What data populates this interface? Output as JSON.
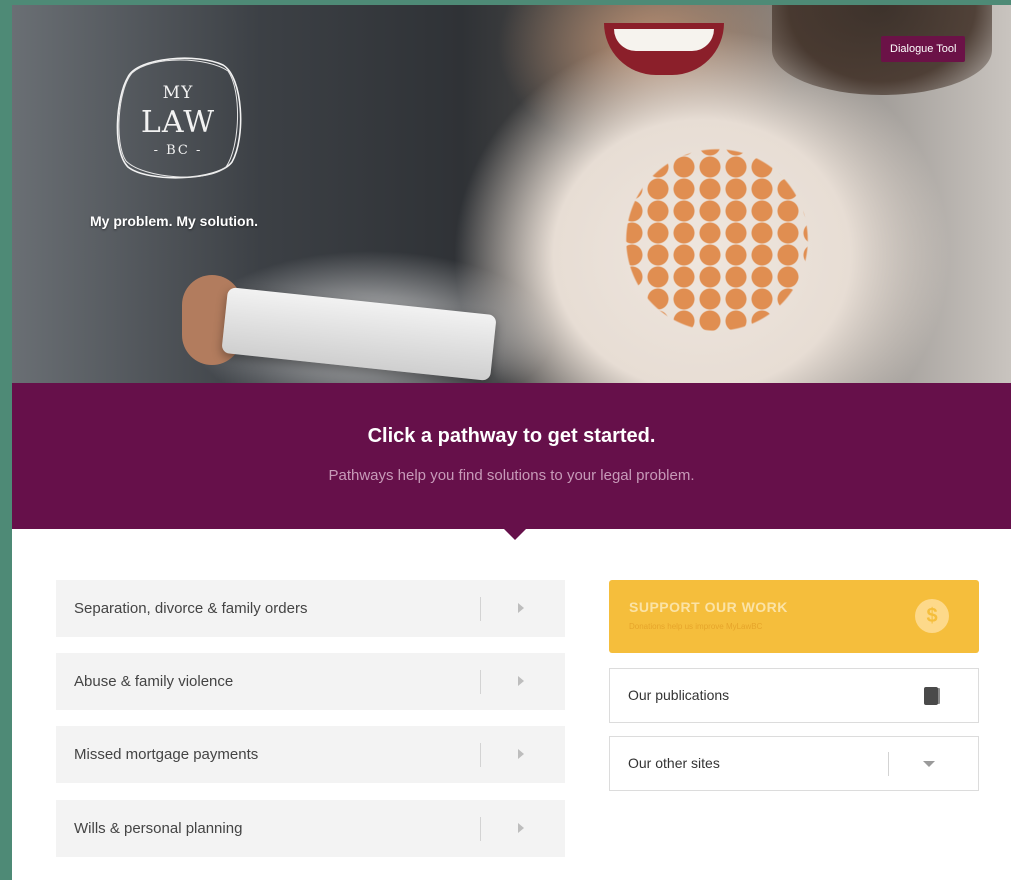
{
  "hero": {
    "logo": {
      "line1": "MY",
      "line2": "LAW",
      "line3": "- BC -"
    },
    "tagline": "My problem. My solution.",
    "dialogue_button": "Dialogue Tool"
  },
  "banner": {
    "title": "Click a pathway to get started.",
    "subtitle": "Pathways help you find solutions to your legal problem."
  },
  "pathways": [
    {
      "label": "Separation, divorce & family orders"
    },
    {
      "label": "Abuse & family violence"
    },
    {
      "label": "Missed mortgage payments"
    },
    {
      "label": "Wills & personal planning"
    }
  ],
  "support": {
    "title": "SUPPORT OUR WORK",
    "subtitle": "Donations help us improve MyLawBC",
    "icon": "$"
  },
  "publications": {
    "label": "Our publications"
  },
  "other_sites": {
    "label": "Our other sites"
  },
  "colors": {
    "brand_purple": "#66104a",
    "support_yellow": "#f5be3c",
    "frame_green": "#4e8a76"
  }
}
